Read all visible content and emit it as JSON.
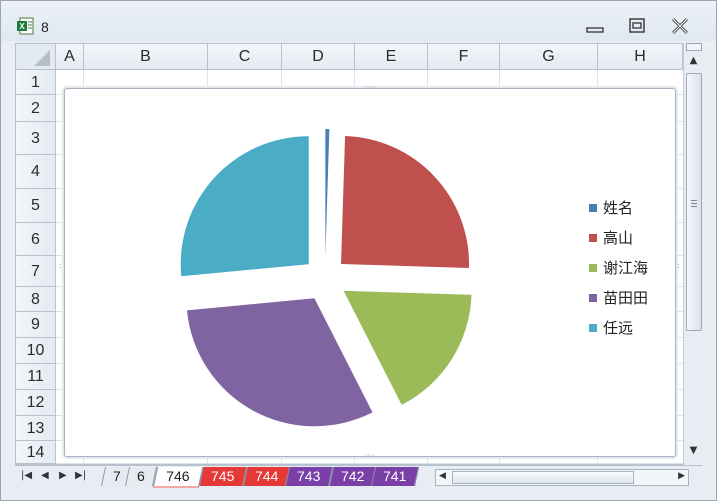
{
  "window": {
    "title": "8",
    "icon": "excel-icon"
  },
  "columns": [
    "A",
    "B",
    "C",
    "D",
    "E",
    "F",
    "G",
    "H"
  ],
  "rows": [
    "1",
    "2",
    "3",
    "4",
    "5",
    "6",
    "7",
    "8",
    "9",
    "10",
    "11",
    "12",
    "13",
    "14"
  ],
  "chart_data": {
    "type": "pie",
    "categories": [
      "姓名",
      "高山",
      "谢江海",
      "苗田田",
      "任远"
    ],
    "values": [
      0.5,
      25,
      17,
      31,
      26.5
    ],
    "colors": [
      "#4a7fb5",
      "#c0504d",
      "#9bbb59",
      "#8064a2",
      "#4bacc6"
    ],
    "exploded": true,
    "legend_position": "right",
    "title": ""
  },
  "sheet_tabs": [
    {
      "label": "7",
      "color": "#e6ebf1"
    },
    {
      "label": "6",
      "color": "#e6ebf1"
    },
    {
      "label": "746",
      "color": "#ffffff",
      "active": true
    },
    {
      "label": "745",
      "color": "#e53935"
    },
    {
      "label": "744",
      "color": "#e53935"
    },
    {
      "label": "743",
      "color": "#7b3fa8"
    },
    {
      "label": "742",
      "color": "#7b3fa8"
    },
    {
      "label": "741",
      "color": "#7b3fa8"
    }
  ]
}
